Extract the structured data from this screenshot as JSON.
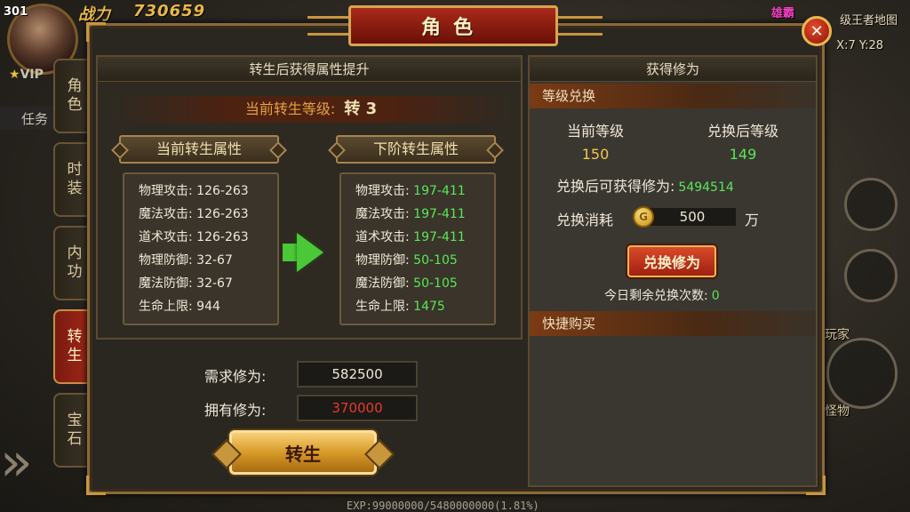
{
  "hud": {
    "player_level": "301",
    "power_label": "战力",
    "power_value": "730659",
    "vip_label": "VIP",
    "task_label": "任务",
    "server_tag": "雄霸",
    "map_label": "级王者地图",
    "coord_text": "X:7  Y:28",
    "side_text_player": "玩家",
    "side_text_monster": "怪物",
    "exp_text": "EXP:99000000/5480000000(1.81%)"
  },
  "side_tabs": [
    {
      "label": "角色",
      "active": false
    },
    {
      "label": "时装",
      "active": false
    },
    {
      "label": "内功",
      "active": false
    },
    {
      "label": "转生",
      "active": true
    },
    {
      "label": "宝石",
      "active": false
    }
  ],
  "panel": {
    "title": "角色",
    "close_symbol": "✕"
  },
  "rebirth": {
    "header": "转生后获得属性提升",
    "level_label": "当前转生等级:",
    "level_value": "转 3",
    "current_title": "当前转生属性",
    "next_title": "下阶转生属性",
    "current_attrs": [
      {
        "name": "物理攻击:",
        "value": "126-263"
      },
      {
        "name": "魔法攻击:",
        "value": "126-263"
      },
      {
        "name": "道术攻击:",
        "value": "126-263"
      },
      {
        "name": "物理防御:",
        "value": "32-67"
      },
      {
        "name": "魔法防御:",
        "value": "32-67"
      },
      {
        "name": "生命上限:",
        "value": "944"
      }
    ],
    "next_attrs": [
      {
        "name": "物理攻击:",
        "value": "197-411"
      },
      {
        "name": "魔法攻击:",
        "value": "197-411"
      },
      {
        "name": "道术攻击:",
        "value": "197-411"
      },
      {
        "name": "物理防御:",
        "value": "50-105"
      },
      {
        "name": "魔法防御:",
        "value": "50-105"
      },
      {
        "name": "生命上限:",
        "value": "1475"
      }
    ],
    "required_label": "需求修为:",
    "required_value": "582500",
    "owned_label": "拥有修为:",
    "owned_value": "370000",
    "button_label": "转生"
  },
  "cultivation": {
    "header": "获得修为",
    "exchange_section": "等级兑换",
    "current_level_label": "当前等级",
    "current_level_value": "150",
    "after_level_label": "兑换后等级",
    "after_level_value": "149",
    "gain_label": "兑换后可获得修为:",
    "gain_value": "5494514",
    "cost_label": "兑换消耗",
    "coin_symbol": "G",
    "cost_value": "500",
    "cost_unit": "万",
    "button_label": "兑换修为",
    "remaining_label": "今日剩余兑换次数:",
    "remaining_value": "0",
    "quick_buy_section": "快捷购买"
  }
}
